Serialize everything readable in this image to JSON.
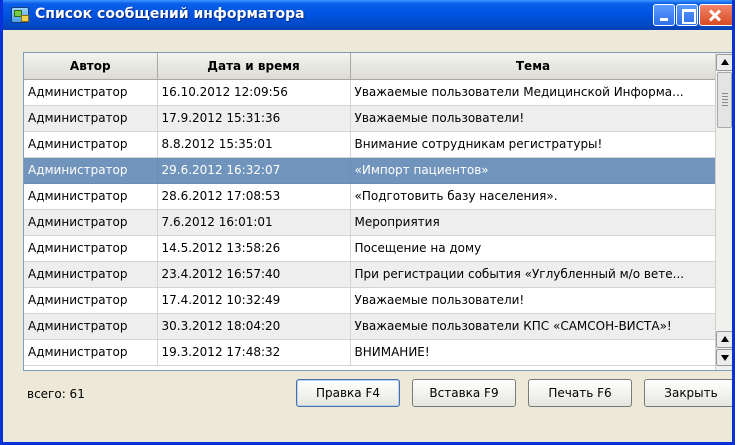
{
  "window": {
    "title": "Список сообщений информатора"
  },
  "table": {
    "columns": [
      "Автор",
      "Дата и время",
      "Тема"
    ],
    "rows": [
      {
        "author": "Администратор",
        "datetime": "16.10.2012 12:09:56",
        "topic": "Уважаемые пользователи Медицинской Информа..."
      },
      {
        "author": "Администратор",
        "datetime": "17.9.2012 15:31:36",
        "topic": "Уважаемые пользователи!"
      },
      {
        "author": "Администратор",
        "datetime": "8.8.2012 15:35:01",
        "topic": "Внимание сотрудникам регистратуры!"
      },
      {
        "author": "Администратор",
        "datetime": "29.6.2012 16:32:07",
        "topic": "«Импорт пациентов»"
      },
      {
        "author": "Администратор",
        "datetime": "28.6.2012 17:08:53",
        "topic": "«Подготовить базу населения»."
      },
      {
        "author": "Администратор",
        "datetime": "7.6.2012 16:01:01",
        "topic": "Мероприятия"
      },
      {
        "author": "Администратор",
        "datetime": "14.5.2012 13:58:26",
        "topic": "Посещение на дому"
      },
      {
        "author": "Администратор",
        "datetime": "23.4.2012 16:57:40",
        "topic": "При регистрации события «Углубленный м/о вете..."
      },
      {
        "author": "Администратор",
        "datetime": "17.4.2012 10:32:49",
        "topic": "Уважаемые пользователи!"
      },
      {
        "author": "Администратор",
        "datetime": "30.3.2012 18:04:20",
        "topic": "Уважаемые пользователи КПС «САМСОН-ВИСТА»!"
      },
      {
        "author": "Администратор",
        "datetime": "19.3.2012 17:48:32",
        "topic": "ВНИМАНИЕ!"
      }
    ],
    "selected_row_index": 3
  },
  "footer": {
    "total_label": "всего: 61",
    "buttons": {
      "edit": "Правка F4",
      "insert": "Вставка F9",
      "print": "Печать F6",
      "close": "Закрыть"
    }
  },
  "colors": {
    "titlebar": "#0054e3",
    "selected_row": "#7194bd",
    "window_bg": "#ece9d8"
  }
}
